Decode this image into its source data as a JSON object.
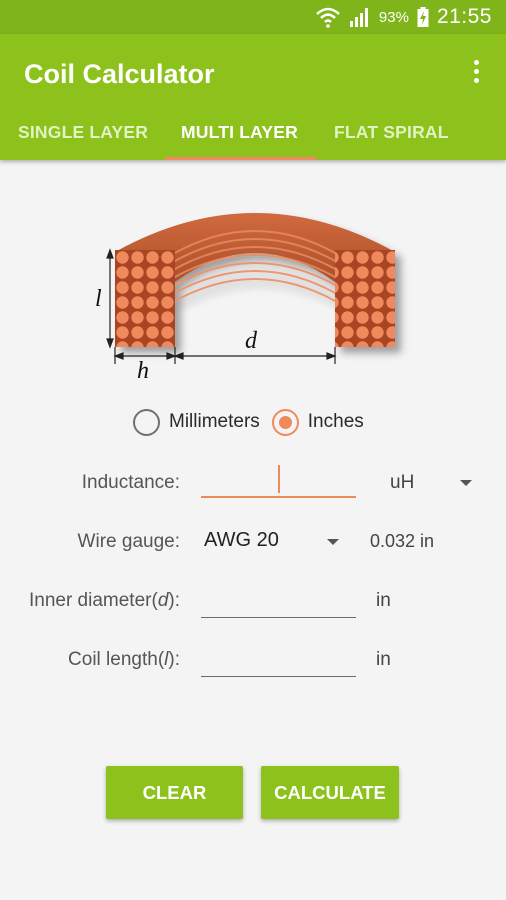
{
  "status_bar": {
    "battery": "93%",
    "time": "21:55",
    "icons": [
      "wifi-icon",
      "signal-icon",
      "battery-charging-icon"
    ]
  },
  "app": {
    "title": "Coil Calculator",
    "menu_icon": "overflow-menu-icon"
  },
  "tabs": [
    {
      "label": "SINGLE LAYER",
      "active": false
    },
    {
      "label": "MULTI LAYER",
      "active": true
    },
    {
      "label": "FLAT SPIRAL",
      "active": false
    }
  ],
  "diagram": {
    "length_label": "l",
    "height_label": "h",
    "diameter_label": "d"
  },
  "units": {
    "options": [
      {
        "label": "Millimeters",
        "checked": false
      },
      {
        "label": "Inches",
        "checked": true
      }
    ]
  },
  "form": {
    "inductance": {
      "label": "Inductance:",
      "value": "",
      "unit": "uH"
    },
    "wire_gauge": {
      "label": "Wire gauge:",
      "value": "AWG 20",
      "info": "0.032 in"
    },
    "inner_diameter": {
      "label_prefix": "Inner diameter(",
      "label_var": "d",
      "label_suffix": "):",
      "value": "",
      "unit": "in"
    },
    "coil_length": {
      "label_prefix": "Coil length(",
      "label_var": "l",
      "label_suffix": "):",
      "value": "",
      "unit": "in"
    }
  },
  "buttons": {
    "clear": "CLEAR",
    "calculate": "CALCULATE"
  },
  "colors": {
    "primary": "#8cc21b",
    "status_bar": "#7fb51a",
    "accent": "#f08a5d",
    "copper": "#c05a30"
  }
}
